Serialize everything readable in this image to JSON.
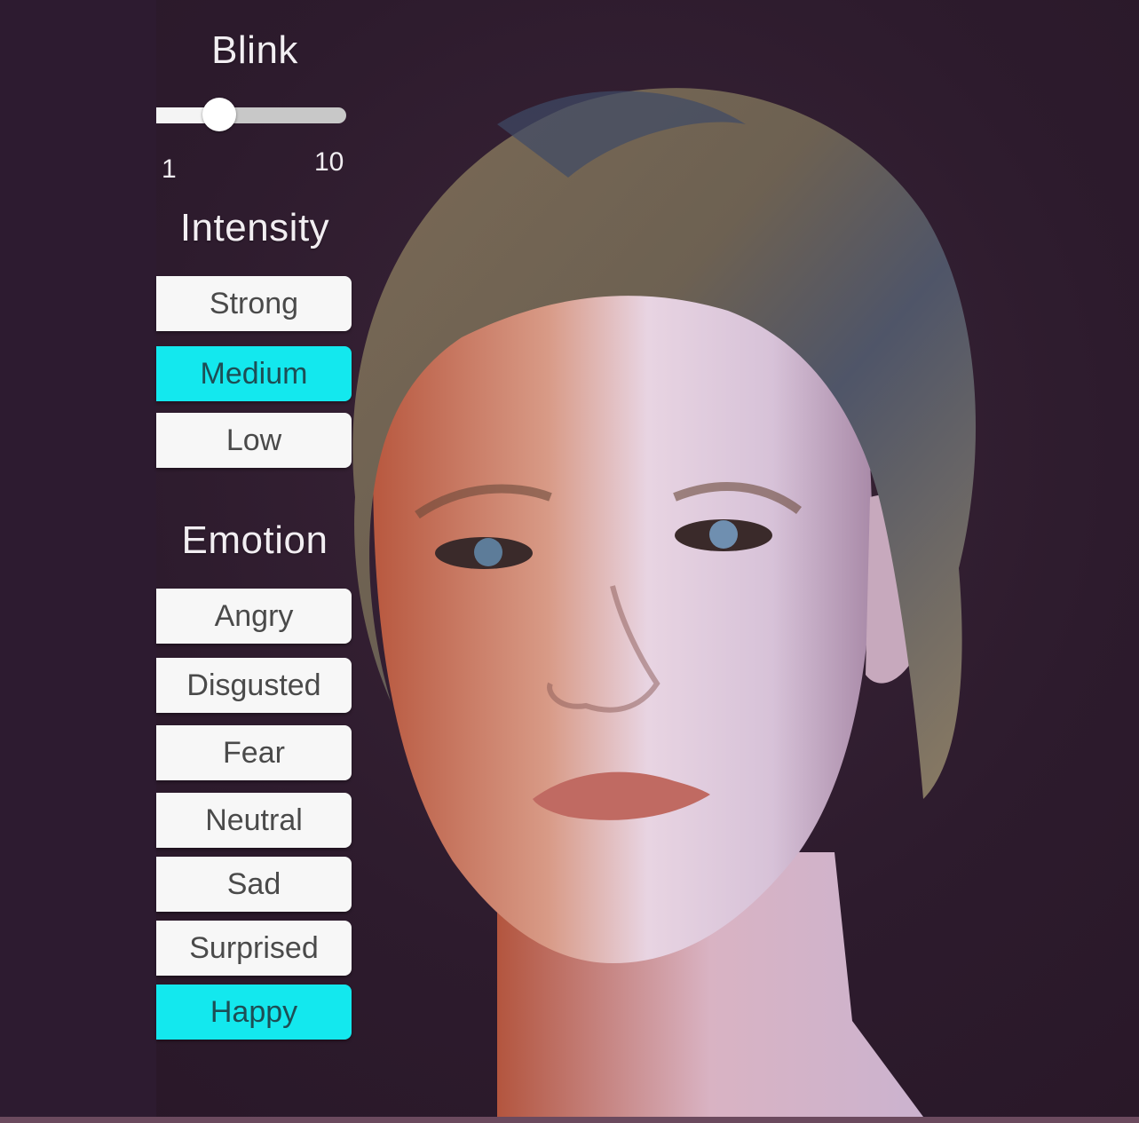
{
  "blink": {
    "title": "Blink",
    "slider_min_label": "1",
    "slider_max_label": "10",
    "min": 1,
    "max": 10,
    "value": 4
  },
  "intensity": {
    "title": "Intensity",
    "options": [
      "Strong",
      "Medium",
      "Low"
    ],
    "selected": "Medium"
  },
  "emotion": {
    "title": "Emotion",
    "options": [
      "Angry",
      "Disgusted",
      "Fear",
      "Neutral",
      "Sad",
      "Surprised",
      "Happy"
    ],
    "selected": "Happy"
  },
  "colors": {
    "background": "#2d1b2d",
    "button": "#f7f7f7",
    "button_active": "#13e8ee",
    "button_text": "#4a4a4a",
    "heading_text": "#f2eef2"
  }
}
